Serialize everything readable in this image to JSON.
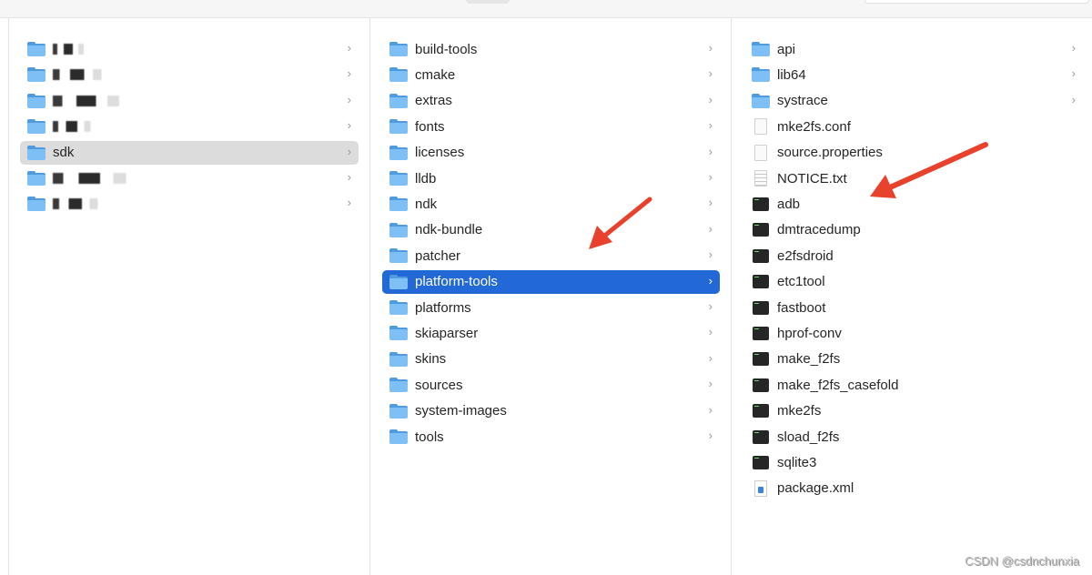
{
  "column1": {
    "items": [
      {
        "label": "",
        "icon": "folder-icon",
        "redacted": true
      },
      {
        "label": "",
        "icon": "folder-icon",
        "redacted": true
      },
      {
        "label": "",
        "icon": "folder-icon",
        "redacted": true
      },
      {
        "label": "",
        "icon": "folder-icon",
        "redacted": true
      },
      {
        "label": "sdk",
        "icon": "folder-icon",
        "selected": true
      },
      {
        "label": "",
        "icon": "folder-icon",
        "redacted": true
      },
      {
        "label": "",
        "icon": "folder-icon",
        "redacted": true
      }
    ]
  },
  "column2": {
    "items": [
      {
        "label": "build-tools"
      },
      {
        "label": "cmake"
      },
      {
        "label": "extras"
      },
      {
        "label": "fonts"
      },
      {
        "label": "licenses"
      },
      {
        "label": "lldb"
      },
      {
        "label": "ndk"
      },
      {
        "label": "ndk-bundle"
      },
      {
        "label": "patcher"
      },
      {
        "label": "platform-tools",
        "selected": true
      },
      {
        "label": "platforms"
      },
      {
        "label": "skiaparser"
      },
      {
        "label": "skins"
      },
      {
        "label": "sources"
      },
      {
        "label": "system-images"
      },
      {
        "label": "tools"
      }
    ]
  },
  "column3": {
    "items": [
      {
        "label": "api",
        "type": "folder"
      },
      {
        "label": "lib64",
        "type": "folder"
      },
      {
        "label": "systrace",
        "type": "folder"
      },
      {
        "label": "mke2fs.conf",
        "type": "doc"
      },
      {
        "label": "source.properties",
        "type": "doc"
      },
      {
        "label": "NOTICE.txt",
        "type": "txt"
      },
      {
        "label": "adb",
        "type": "exec"
      },
      {
        "label": "dmtracedump",
        "type": "exec"
      },
      {
        "label": "e2fsdroid",
        "type": "exec"
      },
      {
        "label": "etc1tool",
        "type": "exec"
      },
      {
        "label": "fastboot",
        "type": "exec"
      },
      {
        "label": "hprof-conv",
        "type": "exec"
      },
      {
        "label": "make_f2fs",
        "type": "exec"
      },
      {
        "label": "make_f2fs_casefold",
        "type": "exec"
      },
      {
        "label": "mke2fs",
        "type": "exec"
      },
      {
        "label": "sload_f2fs",
        "type": "exec"
      },
      {
        "label": "sqlite3",
        "type": "exec"
      },
      {
        "label": "package.xml",
        "type": "xml"
      }
    ]
  },
  "colors": {
    "selection_blue": "#2268d6",
    "selection_gray": "#dcdcdc",
    "annotation_arrow": "#e8412c"
  },
  "watermark": "CSDN @csdnchunxia"
}
